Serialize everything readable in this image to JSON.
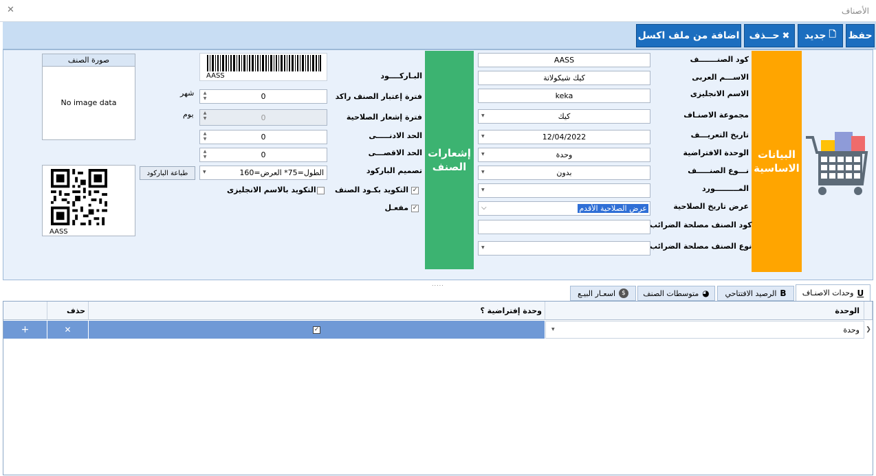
{
  "window": {
    "title": "الأصناف",
    "close": "✕"
  },
  "toolbar": {
    "save": "حفظ",
    "new": "جديد",
    "delete": "حــذف",
    "import_excel": "اضافة من ملف اكسل"
  },
  "basic": {
    "band_label": "البيانات الاساسية",
    "fields": {
      "code_label": "كود الصنـــــــف",
      "code_value": "AASS",
      "arabic_name_label": "الاســـم العربى",
      "arabic_name_value": "كيك شيكولاتة",
      "english_name_label": "الاسم الانجليزى",
      "english_name_value": "keka",
      "group_label": "مجموعة الاصنـاف",
      "group_value": "كيك",
      "def_date_label": "تاريخ التعريـــف",
      "def_date_value": "12/04/2022",
      "default_unit_label": "الوحدة الافتراضية",
      "default_unit_value": "وحدة",
      "type_label": "نـــوع الصنـــــف",
      "type_value": "بدون",
      "supplier_label": "المـــــــــورد",
      "supplier_value": "",
      "expiry_display_label": "عرض تاريخ الصلاحية",
      "expiry_display_value": "عرض الصلاحية الأقدم",
      "tax_code_label": "كود الصنف مصلحة الضرائب",
      "tax_code_value": "",
      "tax_type_label": "نوع الصنف مصلحة الضرائب",
      "tax_type_value": ""
    }
  },
  "alerts": {
    "band_label": "إشعارات الصنف",
    "barcode_label": "البـاركــــود",
    "barcode_text": "AASS",
    "stagnant_label": "فترة إعتبار الصنف راكد",
    "stagnant_value": "0",
    "stagnant_unit": "شهر",
    "expiry_alert_label": "فترة إشعار الصلاحية",
    "expiry_alert_value": "0",
    "expiry_alert_unit": "يوم",
    "min_label": "الحد الادنـــــى",
    "min_value": "0",
    "max_label": "الحد الاقصـــى",
    "max_value": "0",
    "barcode_design_label": "تصميم الباركود",
    "barcode_design_value": "الطول=75* العرض=160",
    "print_barcode": "طباعة الباركود",
    "code_by_item_label": "التكويد بكـود الصنف",
    "code_by_item_checked": true,
    "code_by_english_label": "التكويد بالاسم الانجليزى",
    "code_by_english_checked": false,
    "active_label": "مفعـل",
    "active_checked": true
  },
  "image_box": {
    "header": "صورة الصنف",
    "empty": "No image data"
  },
  "qr": {
    "caption": "AASS"
  },
  "tabs": [
    {
      "label": "وحدات الاصنـاف",
      "icon": "U",
      "active": true
    },
    {
      "label": "الرصيد الافتتاحي",
      "icon": "B",
      "active": false
    },
    {
      "label": "متوسطات الصنف",
      "icon": "◕",
      "active": false
    },
    {
      "label": "اسعـار البيـع",
      "icon": "$",
      "active": false
    }
  ],
  "grid": {
    "headers": {
      "unit": "الوحدة",
      "is_default": "وحدة إفتراضية ؟",
      "delete": "حذف"
    },
    "rows": [
      {
        "unit": "وحدة",
        "is_default": true,
        "delete_icon": "✕",
        "add_icon": "+"
      }
    ]
  },
  "colors": {
    "accent": "#1c6ebf",
    "basic_band": "#ffa500",
    "alerts_band": "#3cb371",
    "selected_row": "#6f99d6"
  }
}
